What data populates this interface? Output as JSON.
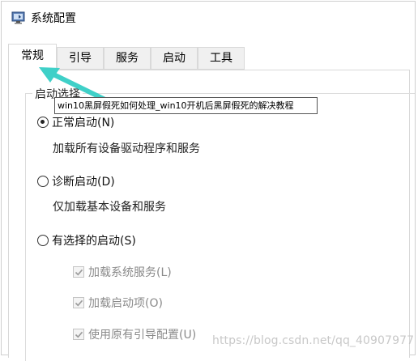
{
  "window": {
    "title": "系统配置"
  },
  "tabs": [
    {
      "label": "常规",
      "active": true
    },
    {
      "label": "引导",
      "active": false
    },
    {
      "label": "服务",
      "active": false
    },
    {
      "label": "启动",
      "active": false
    },
    {
      "label": "工具",
      "active": false
    }
  ],
  "startup": {
    "group_label": "启动选择",
    "options": [
      {
        "label": "正常启动(N)",
        "description": "加载所有设备驱动程序和服务",
        "selected": true
      },
      {
        "label": "诊断启动(D)",
        "description": "仅加载基本设备和服务",
        "selected": false
      },
      {
        "label": "有选择的启动(S)",
        "description": "",
        "selected": false
      }
    ],
    "selective_items": [
      {
        "label": "加载系统服务(L)",
        "checked": true,
        "enabled": false
      },
      {
        "label": "加载启动项(O)",
        "checked": true,
        "enabled": false
      },
      {
        "label": "使用原有引导配置(U)",
        "checked": true,
        "enabled": false
      }
    ]
  },
  "tooltip": "win10黑屏假死如何处理_win10开机后黑屏假死的解决教程",
  "watermark": "https://blog.csdn.net/qq_40907977",
  "colors": {
    "arrow": "#3fd0c8",
    "disabled_text": "#8a8a8a"
  }
}
